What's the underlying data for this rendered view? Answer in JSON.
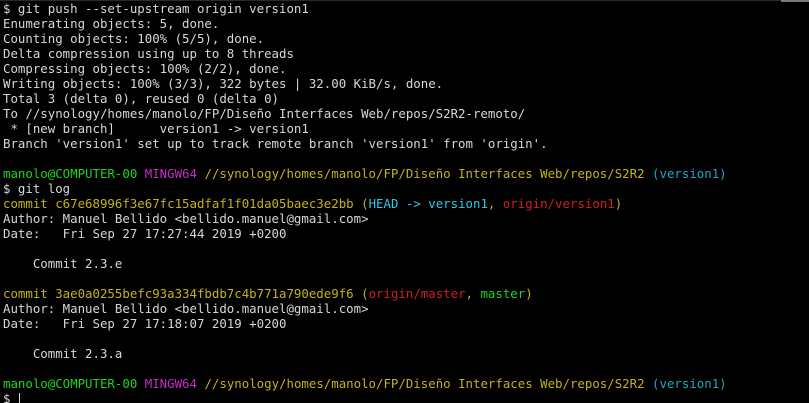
{
  "terminal": {
    "push_cmd": "$ git push --set-upstream origin version1",
    "output": [
      "Enumerating objects: 5, done.",
      "Counting objects: 100% (5/5), done.",
      "Delta compression using up to 8 threads",
      "Compressing objects: 100% (2/2), done.",
      "Writing objects: 100% (3/3), 322 bytes | 32.00 KiB/s, done.",
      "Total 3 (delta 0), reused 0 (delta 0)",
      "To //synology/homes/manolo/FP/Diseño Interfaces Web/repos/S2R2-remoto/",
      " * [new branch]      version1 -> version1",
      "Branch 'version1' set up to track remote branch 'version1' from 'origin'."
    ],
    "prompt": {
      "user_host": "manolo@COMPUTER-00",
      "shell": "MINGW64",
      "path": "//synology/homes/manolo/FP/Diseño Interfaces Web/repos/S2R2",
      "branch": "(version1)"
    },
    "log_cmd": "$ git log",
    "commits": [
      {
        "hash_line": "commit c67e68996f3e67fc15adfaf1f01da05baec3e2bb",
        "ref_open": "(",
        "head": "HEAD -> version1",
        "sep": ", ",
        "remote": "origin/version1",
        "local": "",
        "ref_close": ")",
        "author": "Author: Manuel Bellido <bellido.manuel@gmail.com>",
        "date": "Date:   Fri Sep 27 17:27:44 2019 +0200",
        "message": "    Commit 2.3.e"
      },
      {
        "hash_line": "commit 3ae0a0255befc93a334fbdb7c4b771a790ede9f6",
        "ref_open": "(",
        "remote": "origin/master",
        "sep": ", ",
        "local": "master",
        "ref_close": ")",
        "author": "Author: Manuel Bellido <bellido.manuel@gmail.com>",
        "date": "Date:   Fri Sep 27 17:18:07 2019 +0200",
        "message": "    Commit 2.3.a"
      }
    ],
    "final_prompt_symbol": "$ "
  },
  "colors": {
    "background": "#000000",
    "text": "#d7d7d7",
    "user_host": "#1ed41e",
    "shell": "#c32bc3",
    "path": "#c2b21b",
    "branch": "#1fa8c0",
    "commit_hash": "#c2b21b",
    "head_ref": "#30c8e0",
    "local_branch": "#1ed41e",
    "remote_branch": "#d21f1f"
  }
}
